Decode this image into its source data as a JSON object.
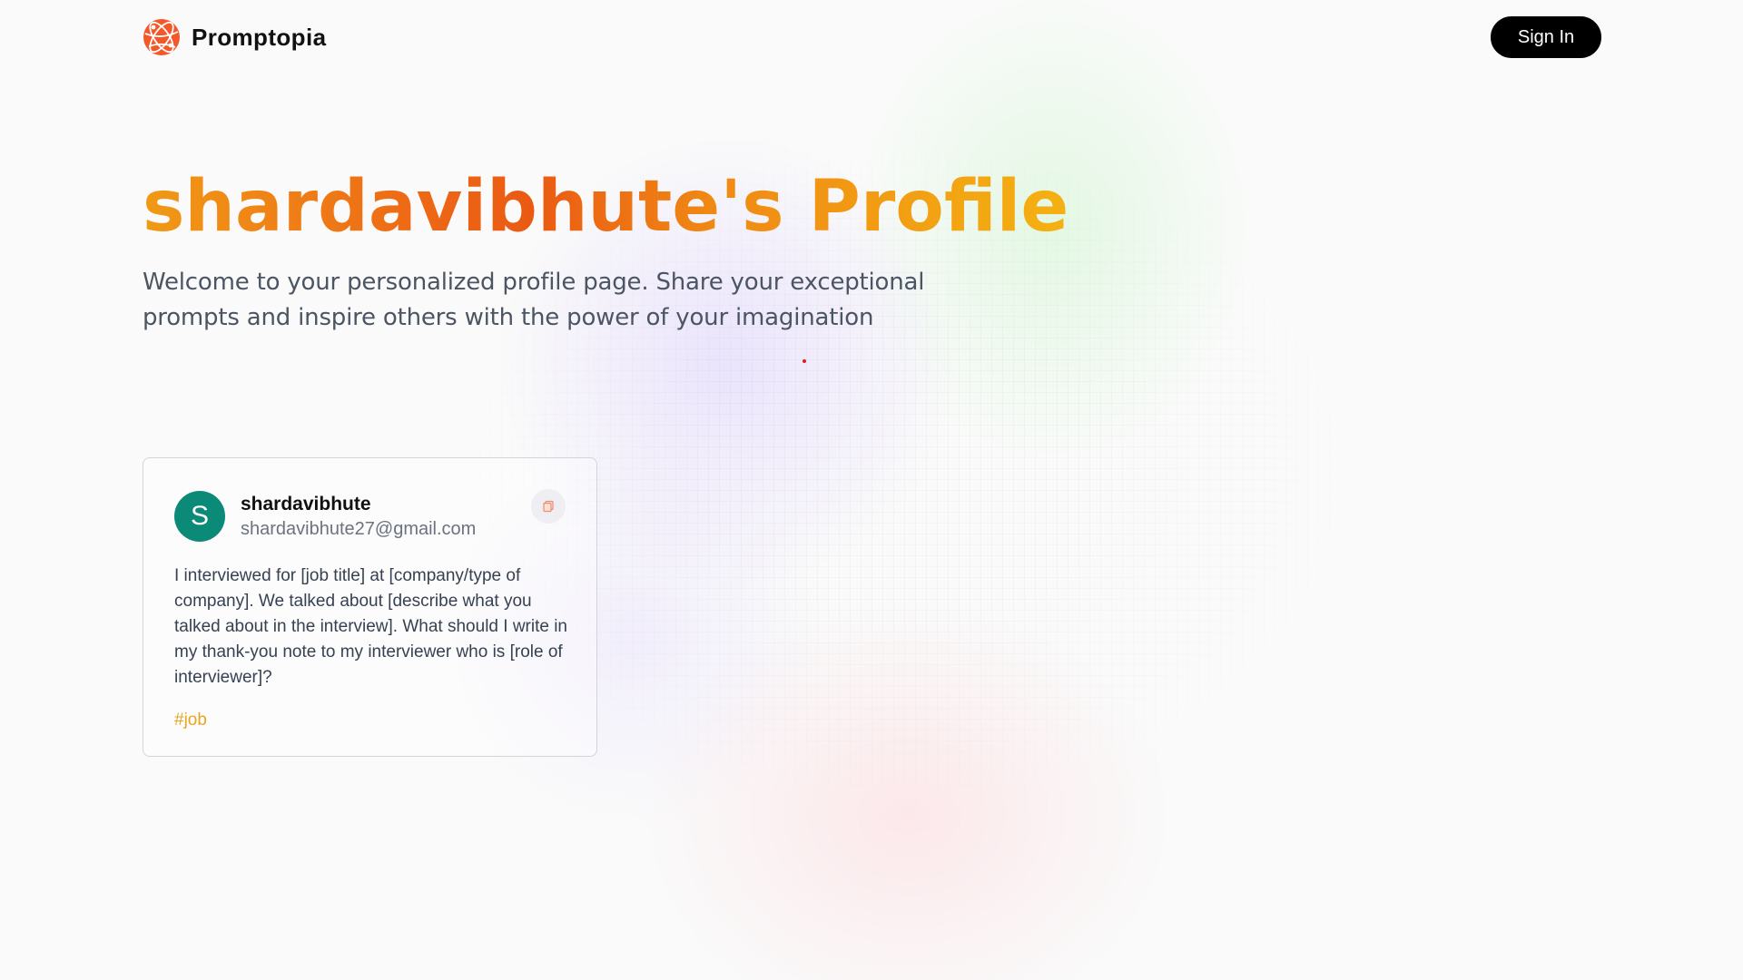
{
  "nav": {
    "brand_name": "Promptopia",
    "logo_icon": "globe-logo-icon",
    "signin_label": "Sign In"
  },
  "hero": {
    "title": "shardavibhute's Profile",
    "subtitle": "Welcome to your personalized profile page. Share your exceptional prompts and inspire others with the power of your imagination"
  },
  "prompts": [
    {
      "avatar_letter": "S",
      "username": "shardavibhute",
      "email": "shardavibhute27@gmail.com",
      "text": "I interviewed for [job title] at [company/type of company]. We talked about [describe what you talked about in the interview]. What should I write in my thank-you note to my interviewer who is [role of interviewer]?",
      "tag": "#job",
      "copy_icon": "copy-icon"
    }
  ],
  "colors": {
    "accent_orange": "#ea5a13",
    "accent_yellow": "#f4b112",
    "avatar_bg": "#0c8a78",
    "tag": "#e9a420",
    "button_bg": "#000000"
  }
}
